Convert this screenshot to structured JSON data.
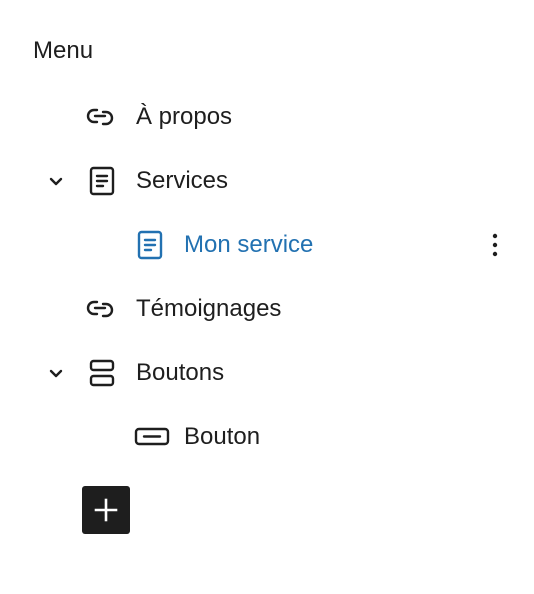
{
  "menu": {
    "title": "Menu",
    "items": [
      {
        "label": "À propos",
        "icon": "custom-link-icon"
      },
      {
        "label": "Services",
        "icon": "page-icon",
        "expanded": true
      },
      {
        "label": "Mon service",
        "icon": "page-icon",
        "selected": true,
        "options_icon": "more-vertical-icon"
      },
      {
        "label": "Témoignages",
        "icon": "custom-link-icon"
      },
      {
        "label": "Boutons",
        "icon": "buttons-block-icon",
        "expanded": true
      },
      {
        "label": "Bouton",
        "icon": "button-block-icon"
      }
    ],
    "add_button_icon": "plus-icon"
  },
  "colors": {
    "text": "#1e1e1e",
    "selected": "#2271b1",
    "add_button_bg": "#1e1e1e"
  }
}
